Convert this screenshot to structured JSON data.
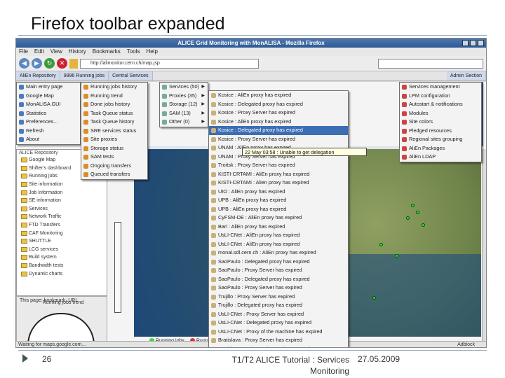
{
  "slide": {
    "title": "Firefox toolbar expanded",
    "page_number": "26",
    "footer_line1": "T1/T2 ALICE Tutorial : Services",
    "footer_line2": "Monitoring",
    "date": "27.05.2009"
  },
  "browser": {
    "window_title": "ALICE Grid Monitoring with MonALISA - Mozilla Firefox",
    "menus": [
      "File",
      "Edit",
      "View",
      "History",
      "Bookmarks",
      "Tools",
      "Help"
    ],
    "url": "http://alimonitor.cern.ch/map.jsp",
    "bookmarks": [
      "AliEn Repository",
      "9996 Running jobs",
      "Central Services",
      "Admin Section"
    ],
    "status_text": "Waiting for maps.google.com...",
    "status_right": "Adblock"
  },
  "menu_repository": {
    "items": [
      "Main entry page",
      "Google Map",
      "MonALISA GUI",
      "Statistics",
      "Preferences...",
      "Refresh",
      "About"
    ]
  },
  "menu_jobs": {
    "items": [
      "Running jobs history",
      "Running trend",
      "Done jobs history",
      "Task Queue status",
      "Task Queue history",
      "SRE services status",
      "Site proxies",
      "Storage status",
      "SAM tests",
      "Ongoing transfers",
      "Queued transfers"
    ]
  },
  "menu_services": {
    "items": [
      "Services (50)",
      "Proxies (35)",
      "Storage (12)",
      "SAM (13)",
      "Other (0)"
    ]
  },
  "menu_proxies": {
    "items": [
      "Kosice : AliEn proxy has expired",
      "Kosice : Delegated proxy has expired",
      "Kosice : Proxy Server has expired",
      "Kosice : AliEn proxy has expired",
      "Kosice : Delegated proxy has expired",
      "Kosice : Proxy Server has expired",
      "UNAM : AliEn proxy has expired",
      "UNAM : Proxy Server has expired",
      "Troitsk : Proxy Server has expired",
      "KISTI-CRTAMI : AliEn proxy has expired",
      "KISTI-CRTAMI : Alien proxy has expired",
      "UIO : AliEn proxy has expired",
      "UPB : AliEn proxy has expired",
      "UPB : AliEn proxy has expired",
      "CyFSM-DE : AliEn proxy has expired",
      "Bari : AliEn proxy has expired",
      "UsLI-CNet : AliEn proxy has expired",
      "UsLI-CNet : AliEn proxy has expired",
      "monal.sdl.cern.ch : AliEn proxy has expired",
      "SaoPaulo : Delegated proxy has expired",
      "SaoPaulo : Proxy Server has expired",
      "SaoPaulo : Delegated proxy has expired",
      "SaoPaulo : Proxy Server has expired",
      "Trujillo : Proxy Server has expired",
      "Trujillo : Delegated proxy has expired",
      "UsLI-CNet : Proxy Server has expired",
      "UsLI-CNet : Delegated proxy has expired",
      "UsLI-CNet : Proxy of the machine has expired",
      "Bratislava : Proxy Server has expired",
      "Bratislava : Delegated proxy has expired"
    ],
    "highlighted_index": 4,
    "tooltip": "22 May 03:58 : Unable to get delegation"
  },
  "menu_admin": {
    "items": [
      "Services management",
      "LPM configuration",
      "Autostart & notifications",
      "Modules",
      "Site colors",
      "Pledged resources",
      "Regional sites grouping",
      "AliEn Packages",
      "AliEn LDAP"
    ]
  },
  "repository_tree": {
    "title": "ALICE Repository",
    "items": [
      "Google Map",
      "Shifter's dashboard",
      "Running jobs",
      "Site information",
      "Job Information",
      "SE information",
      "Services",
      "Network Traffic",
      "FTD Transfers",
      "CAF Monitoring",
      "SHUTTLE",
      "LCG services",
      "Build system",
      "Bandwidth tests",
      "Dynamic charts"
    ]
  },
  "map": {
    "legend": [
      "Running jobs",
      "Running jobs"
    ],
    "gauge_label": "Running jobs trend",
    "this_page_label": "This page: bookmark, URL"
  },
  "colors": {
    "highlight": "#3c6eb4",
    "title_bar": "#2d5a96",
    "site_ok": "#33dd33"
  }
}
